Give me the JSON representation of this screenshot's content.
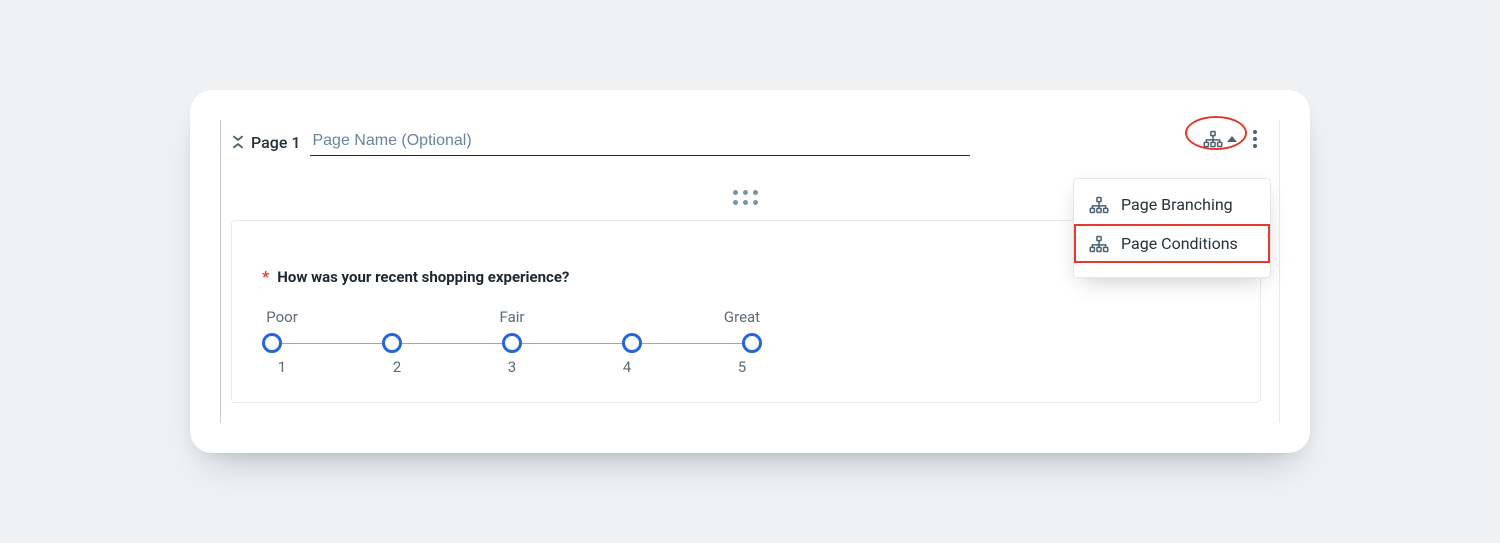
{
  "page": {
    "label": "Page 1",
    "name_placeholder": "Page Name (Optional)",
    "name_value": ""
  },
  "dropdown": {
    "items": [
      {
        "label": "Page Branching",
        "highlighted": false
      },
      {
        "label": "Page Conditions",
        "highlighted": true
      }
    ]
  },
  "question": {
    "required": true,
    "required_mark": "*",
    "text": "How was your recent shopping experience?",
    "scale": {
      "left_label": "Poor",
      "mid_label": "Fair",
      "right_label": "Great",
      "options": [
        "1",
        "2",
        "3",
        "4",
        "5"
      ]
    }
  }
}
